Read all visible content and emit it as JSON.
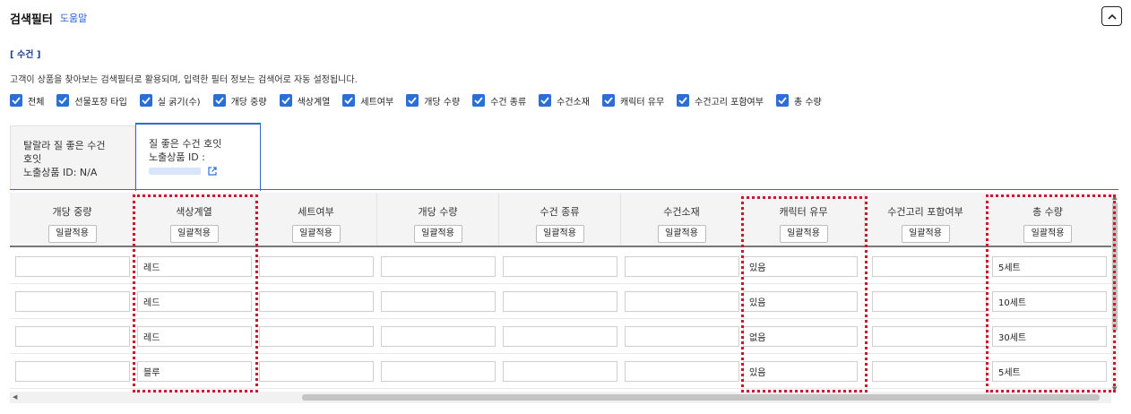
{
  "header": {
    "title": "검색필터",
    "help_link": "도움말"
  },
  "section": {
    "label": "[ 수건 ]",
    "description": "고객이 상품을 찾아보는 검색필터로 활용되며, 입력한 필터 정보는 검색어로 자동 설정됩니다."
  },
  "filters": [
    {
      "label": "전체",
      "checked": true
    },
    {
      "label": "선물포장 타입",
      "checked": true
    },
    {
      "label": "실 굵기(수)",
      "checked": true
    },
    {
      "label": "개당 중량",
      "checked": true
    },
    {
      "label": "색상계열",
      "checked": true
    },
    {
      "label": "세트여부",
      "checked": true
    },
    {
      "label": "개당 수량",
      "checked": true
    },
    {
      "label": "수건 종류",
      "checked": true
    },
    {
      "label": "수건소재",
      "checked": true
    },
    {
      "label": "캐릭터 유무",
      "checked": true
    },
    {
      "label": "수건고리 포함여부",
      "checked": true
    },
    {
      "label": "총 수량",
      "checked": true
    }
  ],
  "tabs": [
    {
      "line1": "탈랄라 질 좋은 수건",
      "line2": "호잇",
      "line3": "노출상품 ID: N/A",
      "active": false
    },
    {
      "line1": "질 좋은 수건 호잇",
      "line2": "노출상품 ID :",
      "active": true
    }
  ],
  "table": {
    "apply_label": "일괄적용",
    "columns": [
      "개당 중량",
      "색상계열",
      "세트여부",
      "개당 수량",
      "수건 종류",
      "수건소재",
      "캐릭터 유무",
      "수건고리 포함여부",
      "총 수량"
    ],
    "rows": [
      [
        "",
        "레드",
        "",
        "",
        "",
        "",
        "있음",
        "",
        "5세트"
      ],
      [
        "",
        "레드",
        "",
        "",
        "",
        "",
        "있음",
        "",
        "10세트"
      ],
      [
        "",
        "레드",
        "",
        "",
        "",
        "",
        "없음",
        "",
        "30세트"
      ],
      [
        "",
        "블루",
        "",
        "",
        "",
        "",
        "있음",
        "",
        "5세트"
      ]
    ]
  },
  "colors": {
    "accent": "#2b6fd6",
    "highlight": "#d3132e"
  }
}
